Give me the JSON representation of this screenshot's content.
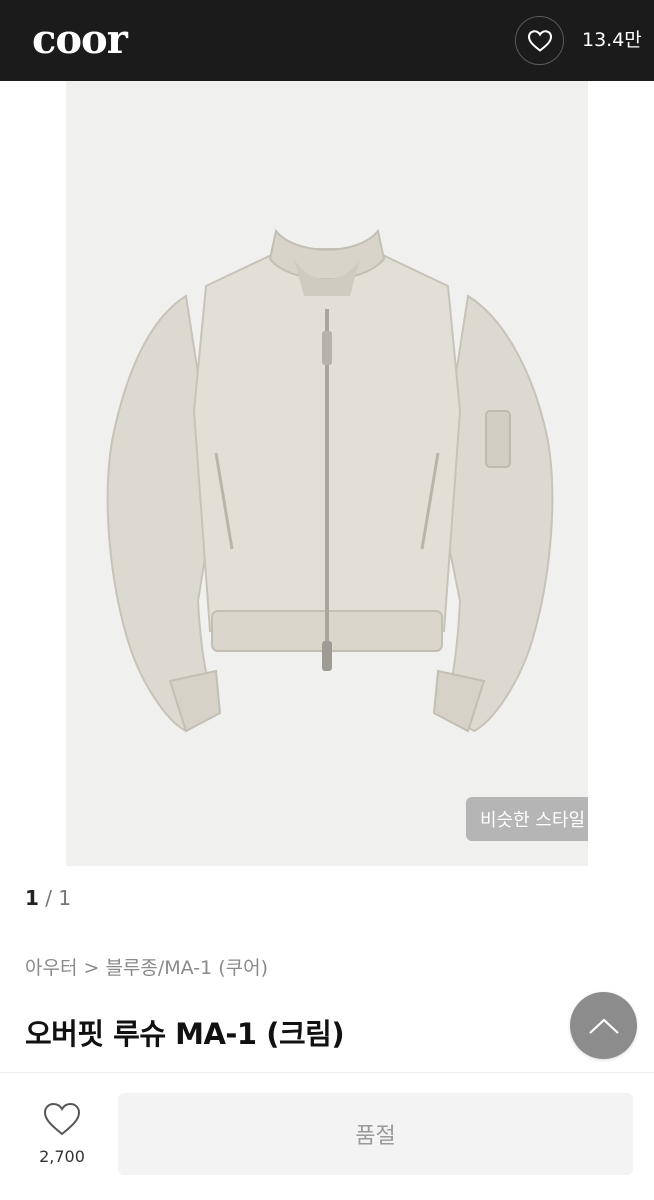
{
  "header": {
    "logo": "coor",
    "like_count": "13.4만",
    "heart_icon": "heart-outline-icon"
  },
  "product_image": {
    "description_icon": "bomber-jacket-image",
    "background": "#f0f0ef",
    "similar_style_label": "비슷한 스타일",
    "chevron_icon": "chevron-right-icon"
  },
  "pager": {
    "current": "1",
    "separator": "/",
    "total": "1"
  },
  "breadcrumb": "아우터 > 블루종/MA-1 (쿠어)",
  "title": "오버핏 루슈 MA-1 (크림)",
  "scroll_top_icon": "arrow-up-icon",
  "bottom_bar": {
    "wish_icon": "heart-outline-icon",
    "wish_count": "2,700",
    "soldout_label": "품절"
  },
  "colors": {
    "header_bg": "#1b1b1b",
    "soldout_bg": "#f3f3f3",
    "scroll_top_bg": "#8c8c8c"
  }
}
